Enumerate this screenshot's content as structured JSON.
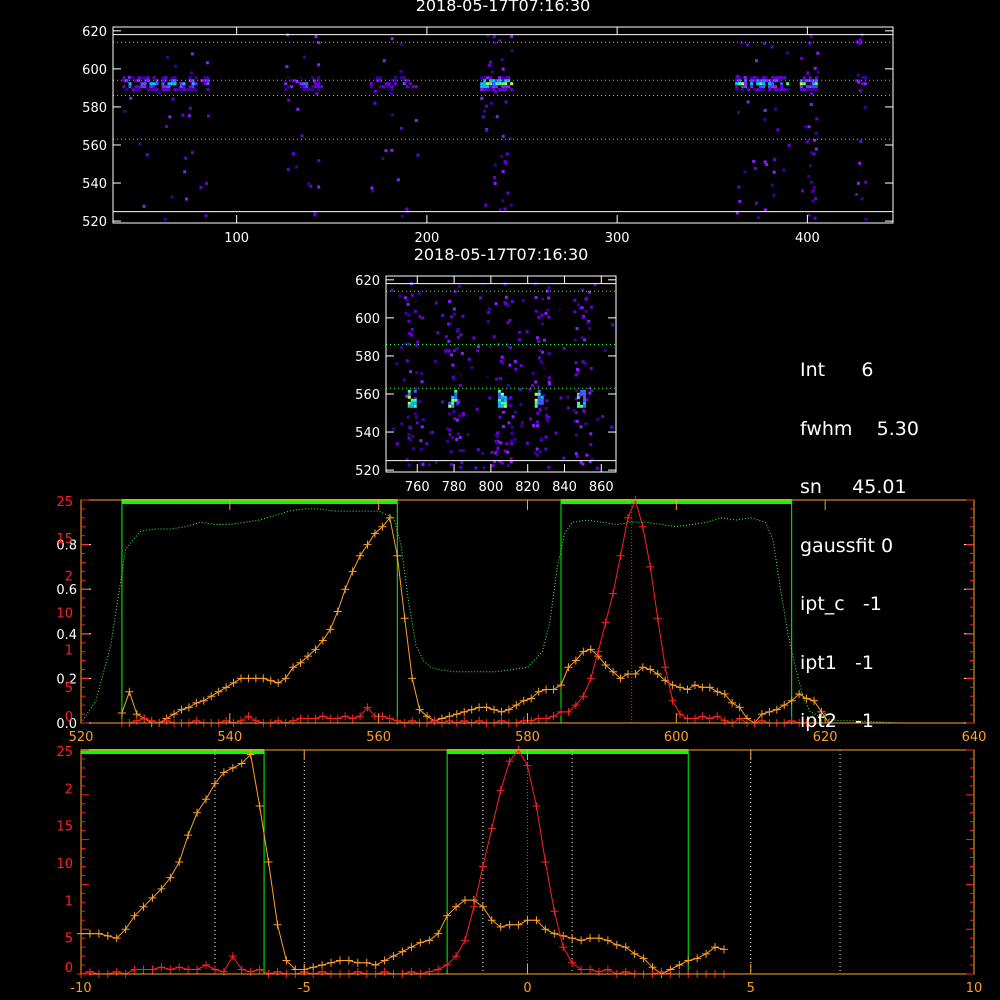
{
  "colors": {
    "background": "#000000",
    "axis": "#ffffff",
    "red": "#ff2020",
    "orange": "#ffa028",
    "green": "#00ff00",
    "green_dotted": "#40ff40",
    "colormap": [
      "#1a0040",
      "#3b00a0",
      "#6a00d8",
      "#8a20ff",
      "#4060ff",
      "#00c0ff",
      "#40ffa0",
      "#c0ff40"
    ]
  },
  "panel_top": {
    "title": "2018-05-17T07:16:30",
    "x_ticks": [
      "100",
      "200",
      "300",
      "400"
    ],
    "y_ticks": [
      "520",
      "540",
      "560",
      "580",
      "600",
      "620"
    ],
    "xlim": [
      35,
      445
    ],
    "ylim": [
      519,
      622
    ],
    "white_lines_y": [
      525,
      618
    ],
    "dotted_lines_y": [
      563,
      586,
      594,
      614
    ],
    "clusters": [
      {
        "x0": 40,
        "x1": 85,
        "y": 593,
        "strength": 0.7
      },
      {
        "x0": 125,
        "x1": 145,
        "y": 593,
        "strength": 0.55
      },
      {
        "x0": 170,
        "x1": 195,
        "y": 593,
        "strength": 0.5
      },
      {
        "x0": 228,
        "x1": 245,
        "y": 593,
        "strength": 0.95
      },
      {
        "x0": 362,
        "x1": 390,
        "y": 593,
        "strength": 0.85
      },
      {
        "x0": 396,
        "x1": 405,
        "y": 593,
        "strength": 0.8
      },
      {
        "x0": 425,
        "x1": 430,
        "y": 593,
        "strength": 0.4
      }
    ]
  },
  "panel_mid": {
    "title": "2018-05-17T07:16:30",
    "x_ticks": [
      "760",
      "780",
      "800",
      "820",
      "840",
      "860"
    ],
    "y_ticks": [
      "520",
      "540",
      "560",
      "580",
      "600",
      "620"
    ],
    "xlim": [
      743,
      868
    ],
    "ylim": [
      519,
      622
    ],
    "white_lines_y": [
      525,
      618
    ],
    "dotted_lines_y": [
      563,
      586,
      614
    ],
    "columns_x": [
      757,
      779,
      806,
      826,
      849
    ]
  },
  "info": {
    "lines": [
      "Int      6",
      "fwhm    5.30",
      "sn     45.01",
      "gaussfit 0",
      "ipt_c   -1",
      "ipt1   -1",
      "ipt2   -1"
    ]
  },
  "chart_data": [
    {
      "type": "line",
      "x_ticks": [
        "520",
        "540",
        "560",
        "580",
        "600",
        "620",
        "640"
      ],
      "xlim": [
        520,
        640
      ],
      "left_axis_white_ticks": [
        "0.0",
        "0.2",
        "0.4",
        "0.6",
        "0.8"
      ],
      "left_axis_red_ticks": [
        "0",
        "5",
        "1",
        "10",
        "2",
        "15",
        "25"
      ],
      "green_boxes": [
        [
          525.5,
          562.5
        ],
        [
          584.5,
          615.5
        ]
      ],
      "red_marker_x": 594,
      "series": [
        {
          "color": "orange",
          "x": [
            525.5,
            526.5,
            527.5,
            528.5,
            529.5,
            530.5,
            531.5,
            532.5,
            533.5,
            534.5,
            535.5,
            536.5,
            537.5,
            538.5,
            539.5,
            540.5,
            541.5,
            542.5,
            543.5,
            544.5,
            545.5,
            546.5,
            547.5,
            548.5,
            549.5,
            550.5,
            551.5,
            552.5,
            553.5,
            554.5,
            555.5,
            556.5,
            557.5,
            558.5,
            559.5,
            560.5,
            561.5,
            562.5,
            563.5,
            564.5,
            565.5,
            566.5,
            567.5,
            568.5,
            569.5,
            570.5,
            571.5,
            572.5,
            573.5,
            574.5,
            575.5,
            576.5,
            577.5,
            578.5,
            579.5,
            580.5,
            581.5,
            582.5,
            583.5,
            584.5,
            585.5,
            586.5,
            587.5,
            588.5,
            589.5,
            590.5,
            591.5,
            592.5,
            593.5,
            594.5,
            595.5,
            596.5,
            597.5,
            598.5,
            599.5,
            600.5,
            601.5,
            602.5,
            603.5,
            604.5,
            605.5,
            606.5,
            607.5,
            608.5,
            609.5,
            610.5,
            611.5,
            612.5,
            613.5,
            614.5,
            615.5,
            616.5,
            617.5,
            618.5,
            619.5,
            620.5
          ],
          "y": [
            0.045,
            0.14,
            0.04,
            0.02,
            0.0,
            0.0,
            0.02,
            0.04,
            0.06,
            0.07,
            0.09,
            0.1,
            0.12,
            0.14,
            0.16,
            0.18,
            0.2,
            0.2,
            0.2,
            0.2,
            0.19,
            0.18,
            0.2,
            0.25,
            0.27,
            0.3,
            0.33,
            0.37,
            0.42,
            0.5,
            0.6,
            0.68,
            0.75,
            0.8,
            0.85,
            0.88,
            0.92,
            0.75,
            0.47,
            0.2,
            0.06,
            0.03,
            0.01,
            0.02,
            0.03,
            0.04,
            0.05,
            0.06,
            0.07,
            0.07,
            0.06,
            0.05,
            0.06,
            0.08,
            0.1,
            0.11,
            0.14,
            0.15,
            0.15,
            0.17,
            0.25,
            0.28,
            0.32,
            0.33,
            0.3,
            0.26,
            0.23,
            0.2,
            0.22,
            0.22,
            0.25,
            0.24,
            0.22,
            0.19,
            0.17,
            0.16,
            0.15,
            0.17,
            0.16,
            0.16,
            0.14,
            0.13,
            0.09,
            0.07,
            0.02,
            0.0,
            0.04,
            0.05,
            0.06,
            0.08,
            0.1,
            0.13,
            0.11,
            0.1,
            0.05,
            0.0
          ]
        },
        {
          "color": "red",
          "x": [
            525.5,
            526.5,
            527.5,
            528.5,
            529.5,
            530.5,
            531.5,
            532.5,
            533.5,
            534.5,
            535.5,
            536.5,
            537.5,
            538.5,
            539.5,
            540.5,
            541.5,
            542.5,
            543.5,
            544.5,
            545.5,
            546.5,
            547.5,
            548.5,
            549.5,
            550.5,
            551.5,
            552.5,
            553.5,
            554.5,
            555.5,
            556.5,
            557.5,
            558.5,
            559.5,
            560.5,
            561.5,
            562.5,
            563.5,
            564.5,
            565.5,
            566.5,
            567.5,
            568.5,
            569.5,
            570.5,
            571.5,
            572.5,
            573.5,
            574.5,
            575.5,
            576.5,
            577.5,
            578.5,
            579.5,
            580.5,
            581.5,
            582.5,
            583.5,
            584.5,
            585.5,
            586.5,
            587.5,
            588.5,
            589.5,
            590.5,
            591.5,
            592.5,
            593.5,
            594.5,
            595.5,
            596.5,
            597.5,
            598.5,
            599.5,
            600.5,
            601.5,
            602.5,
            603.5,
            604.5,
            605.5,
            606.5,
            607.5,
            608.5,
            609.5,
            610.5,
            611.5,
            612.5,
            613.5,
            614.5,
            615.5,
            616.5,
            617.5,
            618.5,
            619.5,
            620.5
          ],
          "y": [
            0.0,
            0.0,
            0.01,
            0.02,
            0.01,
            0.0,
            0.01,
            0.0,
            0.0,
            0.0,
            0.01,
            0.0,
            0.0,
            0.0,
            0.01,
            0.0,
            0.01,
            0.03,
            0.01,
            0.0,
            0.0,
            0.01,
            0.0,
            0.01,
            0.02,
            0.02,
            0.02,
            0.03,
            0.02,
            0.02,
            0.03,
            0.02,
            0.03,
            0.07,
            0.03,
            0.03,
            0.02,
            0.01,
            0.0,
            0.01,
            0.0,
            0.0,
            0.01,
            0.0,
            0.01,
            0.0,
            0.01,
            0.0,
            0.01,
            0.0,
            0.0,
            0.01,
            0.0,
            0.0,
            0.01,
            0.01,
            0.02,
            0.02,
            0.03,
            0.05,
            0.05,
            0.08,
            0.12,
            0.2,
            0.32,
            0.45,
            0.58,
            0.75,
            0.92,
            1.0,
            0.88,
            0.7,
            0.47,
            0.25,
            0.1,
            0.04,
            0.02,
            0.02,
            0.03,
            0.02,
            0.03,
            0.01,
            0.0,
            0.02,
            0.0,
            0.0,
            0.01,
            0.0,
            0.0,
            0.0,
            0.01,
            0.0,
            0.0,
            0.0,
            0.0,
            0.0
          ]
        },
        {
          "color": "green_dotted",
          "x": [
            520,
            522,
            524,
            526,
            528,
            530,
            532,
            534,
            536,
            538,
            540,
            542,
            544,
            546,
            548,
            550,
            552,
            554,
            556,
            558,
            560,
            562,
            563,
            564,
            565,
            566,
            567,
            568,
            570,
            572,
            574,
            576,
            578,
            580,
            582,
            583,
            584,
            585,
            586,
            588,
            590,
            592,
            594,
            596,
            598,
            600,
            602,
            604,
            606,
            608,
            610,
            612,
            613,
            614,
            615,
            616,
            617,
            618,
            620,
            622,
            624,
            630,
            640
          ],
          "y": [
            0.0,
            0.1,
            0.35,
            0.78,
            0.86,
            0.87,
            0.87,
            0.88,
            0.9,
            0.89,
            0.89,
            0.9,
            0.91,
            0.93,
            0.95,
            0.96,
            0.96,
            0.95,
            0.95,
            0.95,
            0.95,
            0.92,
            0.8,
            0.55,
            0.35,
            0.28,
            0.25,
            0.24,
            0.23,
            0.23,
            0.23,
            0.23,
            0.24,
            0.25,
            0.32,
            0.45,
            0.7,
            0.85,
            0.9,
            0.91,
            0.9,
            0.89,
            0.9,
            0.9,
            0.89,
            0.88,
            0.89,
            0.9,
            0.92,
            0.91,
            0.92,
            0.9,
            0.82,
            0.6,
            0.4,
            0.25,
            0.12,
            0.05,
            0.02,
            0.01,
            0.01,
            0.0,
            0.0
          ]
        }
      ]
    },
    {
      "type": "line",
      "x_ticks": [
        "-10",
        "-5",
        "0",
        "5",
        "10"
      ],
      "xlim": [
        -10,
        10
      ],
      "left_axis_red_ticks": [
        "0",
        "5",
        "1",
        "10",
        "15",
        "2",
        "25"
      ],
      "green_boxes": [
        [
          -10,
          -5.9
        ],
        [
          -1.8,
          3.6
        ]
      ],
      "dotted_lines_x": [
        -7,
        -5,
        -1,
        1,
        5,
        7
      ],
      "red_marker_x": 0,
      "series": [
        {
          "color": "orange",
          "x": [
            -10.0,
            -9.8,
            -9.6,
            -9.4,
            -9.2,
            -9.0,
            -8.8,
            -8.6,
            -8.4,
            -8.2,
            -8.0,
            -7.8,
            -7.6,
            -7.4,
            -7.2,
            -7.0,
            -6.8,
            -6.6,
            -6.4,
            -6.2,
            -6.0,
            -5.8,
            -5.6,
            -5.4,
            -5.2,
            -5.0,
            -4.8,
            -4.6,
            -4.4,
            -4.2,
            -4.0,
            -3.8,
            -3.6,
            -3.4,
            -3.2,
            -3.0,
            -2.8,
            -2.6,
            -2.4,
            -2.2,
            -2.0,
            -1.8,
            -1.6,
            -1.4,
            -1.2,
            -1.0,
            -0.8,
            -0.6,
            -0.4,
            -0.2,
            0.0,
            0.2,
            0.4,
            0.6,
            0.8,
            1.0,
            1.2,
            1.4,
            1.6,
            1.8,
            2.0,
            2.2,
            2.4,
            2.6,
            2.8,
            3.0,
            3.2,
            3.4,
            3.6,
            3.8,
            4.0,
            4.2,
            4.4
          ],
          "y": [
            0.18,
            0.18,
            0.18,
            0.17,
            0.16,
            0.2,
            0.26,
            0.3,
            0.34,
            0.38,
            0.43,
            0.5,
            0.62,
            0.72,
            0.78,
            0.85,
            0.9,
            0.92,
            0.94,
            0.98,
            0.75,
            0.5,
            0.22,
            0.06,
            0.02,
            0.02,
            0.03,
            0.04,
            0.05,
            0.06,
            0.06,
            0.05,
            0.05,
            0.04,
            0.06,
            0.08,
            0.1,
            0.12,
            0.14,
            0.15,
            0.18,
            0.26,
            0.3,
            0.33,
            0.33,
            0.3,
            0.24,
            0.21,
            0.22,
            0.22,
            0.24,
            0.24,
            0.2,
            0.18,
            0.17,
            0.16,
            0.15,
            0.16,
            0.16,
            0.15,
            0.13,
            0.12,
            0.09,
            0.07,
            0.03,
            0.0,
            0.02,
            0.04,
            0.06,
            0.07,
            0.09,
            0.12,
            0.11
          ]
        },
        {
          "color": "red",
          "x": [
            -10.0,
            -9.8,
            -9.6,
            -9.4,
            -9.2,
            -9.0,
            -8.8,
            -8.6,
            -8.4,
            -8.2,
            -8.0,
            -7.8,
            -7.6,
            -7.4,
            -7.2,
            -7.0,
            -6.8,
            -6.6,
            -6.4,
            -6.2,
            -6.0,
            -5.8,
            -5.6,
            -5.4,
            -5.2,
            -5.0,
            -4.8,
            -4.6,
            -4.4,
            -4.2,
            -4.0,
            -3.8,
            -3.6,
            -3.4,
            -3.2,
            -3.0,
            -2.8,
            -2.6,
            -2.4,
            -2.2,
            -2.0,
            -1.8,
            -1.6,
            -1.4,
            -1.2,
            -1.0,
            -0.8,
            -0.6,
            -0.4,
            -0.2,
            0.0,
            0.2,
            0.4,
            0.6,
            0.8,
            1.0,
            1.2,
            1.4,
            1.6,
            1.8,
            2.0,
            2.2,
            2.4,
            2.6,
            2.8,
            3.0,
            3.2,
            3.4,
            3.6,
            3.8,
            4.0,
            4.2,
            4.4
          ],
          "y": [
            0.0,
            0.01,
            0.0,
            0.0,
            0.01,
            0.0,
            0.02,
            0.02,
            0.02,
            0.03,
            0.02,
            0.03,
            0.02,
            0.02,
            0.04,
            0.02,
            0.01,
            0.08,
            0.02,
            0.01,
            0.02,
            0.0,
            0.01,
            0.0,
            0.0,
            0.01,
            0.0,
            0.01,
            0.0,
            0.0,
            0.0,
            0.01,
            0.0,
            0.0,
            0.01,
            0.0,
            0.0,
            0.01,
            0.0,
            0.01,
            0.02,
            0.04,
            0.08,
            0.15,
            0.3,
            0.48,
            0.65,
            0.82,
            0.95,
            1.0,
            0.93,
            0.75,
            0.5,
            0.28,
            0.12,
            0.05,
            0.02,
            0.02,
            0.01,
            0.02,
            0.0,
            0.01,
            0.0,
            0.0,
            0.0,
            0.01,
            0.0,
            0.0,
            0.0,
            0.0,
            0.0,
            0.0,
            0.0
          ]
        }
      ]
    }
  ]
}
